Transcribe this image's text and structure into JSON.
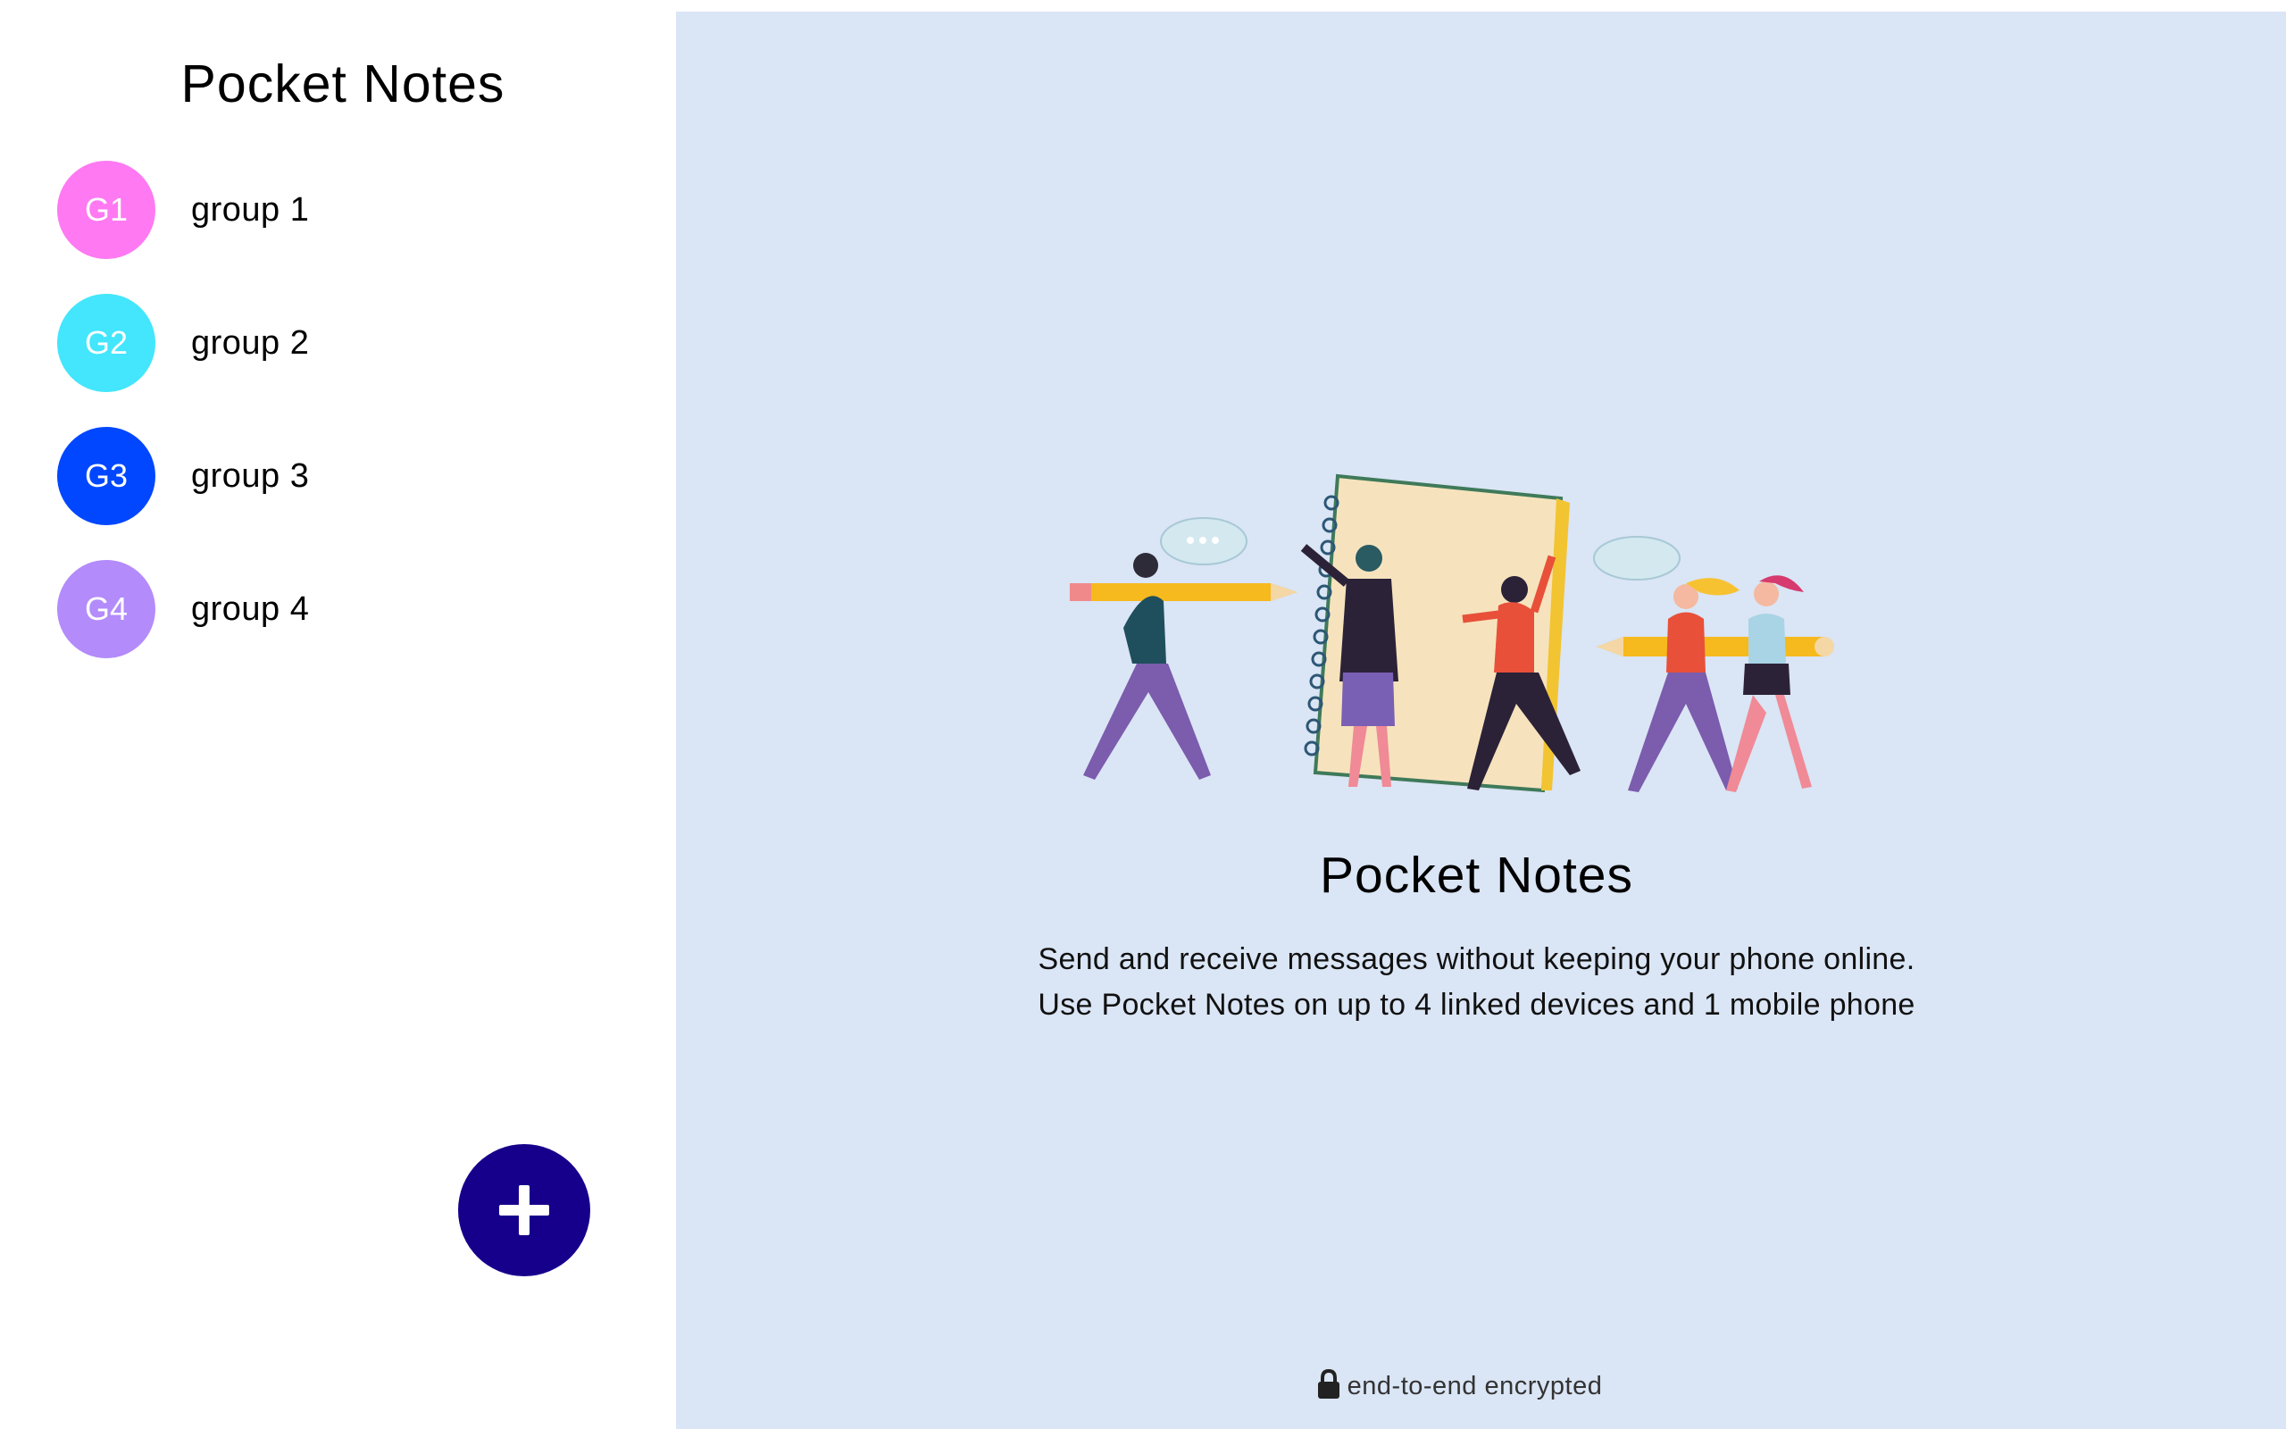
{
  "sidebar": {
    "title": "Pocket Notes",
    "groups": [
      {
        "initials": "G1",
        "name": "group 1",
        "color": "#ff79f2"
      },
      {
        "initials": "G2",
        "name": "group 2",
        "color": "#43e6fc"
      },
      {
        "initials": "G3",
        "name": "group 3",
        "color": "#0047ff"
      },
      {
        "initials": "G4",
        "name": "group 4",
        "color": "#b38bfa"
      }
    ],
    "add_button_icon": "plus-icon",
    "add_button_color": "#16008b"
  },
  "main": {
    "background": "#dae5f5",
    "title": "Pocket Notes",
    "description_line1": "Send and receive messages without keeping your phone online.",
    "description_line2": "Use Pocket Notes on up to 4 linked devices and 1 mobile phone",
    "footer_icon": "lock-icon",
    "footer_text": "end-to-end encrypted"
  }
}
